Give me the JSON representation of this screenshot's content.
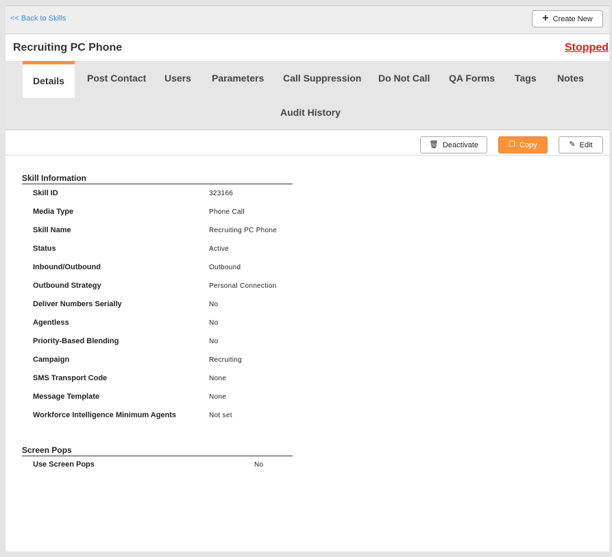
{
  "header": {
    "back_link": "<< Back to Skills",
    "create_new": "Create New"
  },
  "title": {
    "name": "Recruiting PC Phone",
    "status": "Stopped",
    "status_color": "#e31b1b"
  },
  "tabs": [
    {
      "label": "Details",
      "active": true
    },
    {
      "label": "Post Contact"
    },
    {
      "label": "Users"
    },
    {
      "label": "Parameters"
    },
    {
      "label": "Call Suppression"
    },
    {
      "label": "Do Not Call"
    },
    {
      "label": "QA Forms"
    },
    {
      "label": "Tags"
    },
    {
      "label": "Notes"
    },
    {
      "label": "Audit History"
    }
  ],
  "actions": {
    "deactivate": "Deactivate",
    "copy": "Copy",
    "edit": "Edit",
    "accent_color": "#f7943b"
  },
  "skill_information": {
    "heading": "Skill Information",
    "rows": [
      {
        "label": "Skill ID",
        "value": "323166"
      },
      {
        "label": "Media Type",
        "value": "Phone Call"
      },
      {
        "label": "Skill Name",
        "value": "Recruiting PC Phone"
      },
      {
        "label": "Status",
        "value": "Active"
      },
      {
        "label": "Inbound/Outbound",
        "value": "Outbound"
      },
      {
        "label": "Outbound Strategy",
        "value": "Personal Connection"
      },
      {
        "label": "Deliver Numbers Serially",
        "value": "No"
      },
      {
        "label": "Agentless",
        "value": "No"
      },
      {
        "label": "Priority-Based Blending",
        "value": "No"
      },
      {
        "label": "Campaign",
        "value": "Recruiting"
      },
      {
        "label": "SMS Transport Code",
        "value": "None"
      },
      {
        "label": "Message Template",
        "value": "None"
      },
      {
        "label": "Workforce Intelligence Minimum Agents",
        "value": "Not set"
      }
    ]
  },
  "screen_pops": {
    "heading": "Screen Pops",
    "rows": [
      {
        "label": "Use Screen Pops",
        "value": "No"
      }
    ]
  }
}
